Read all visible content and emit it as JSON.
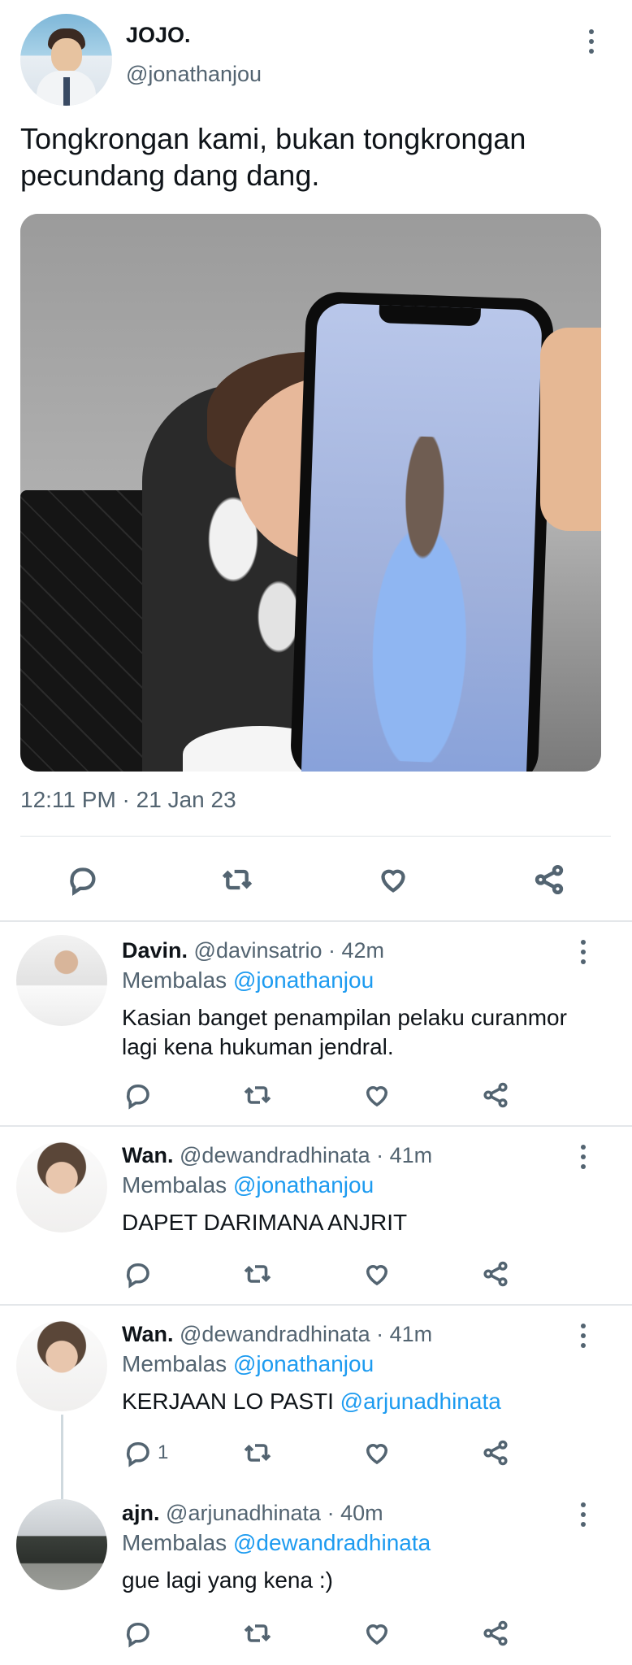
{
  "tweet": {
    "author_name": "JOJO.",
    "author_handle": "@jonathanjou",
    "text": "Tongkrongan kami, bukan tongkrongan pecundang dang dang.",
    "timestamp": "12:11 PM · 21 Jan 23"
  },
  "replies": [
    {
      "name": "Davin.",
      "meta": "@davinsatrio · 42m",
      "replying_label": "Membalas",
      "replying_to": "@jonathanjou",
      "text": "Kasian banget penampilan pelaku curanmor lagi kena hukuman jendral.",
      "mention": "",
      "reply_count": ""
    },
    {
      "name": "Wan.",
      "meta": "@dewandradhinata · 41m",
      "replying_label": "Membalas",
      "replying_to": "@jonathanjou",
      "text": "DAPET DARIMANA ANJRIT",
      "mention": "",
      "reply_count": ""
    },
    {
      "name": "Wan.",
      "meta": "@dewandradhinata · 41m",
      "replying_label": "Membalas",
      "replying_to": "@jonathanjou",
      "text": "KERJAAN LO PASTI ",
      "mention": "@arjunadhinata",
      "reply_count": "1"
    },
    {
      "name": "ajn.",
      "meta": "@arjunadhinata · 40m",
      "replying_label": "Membalas",
      "replying_to": "@dewandradhinata",
      "text": "gue lagi yang kena :)",
      "mention": "",
      "reply_count": ""
    }
  ],
  "colors": {
    "link": "#1d9bf0",
    "secondary_text": "#536471",
    "primary_text": "#0f1419"
  },
  "icons": [
    "more-vertical-icon",
    "reply-icon",
    "retweet-icon",
    "like-icon",
    "share-icon"
  ]
}
